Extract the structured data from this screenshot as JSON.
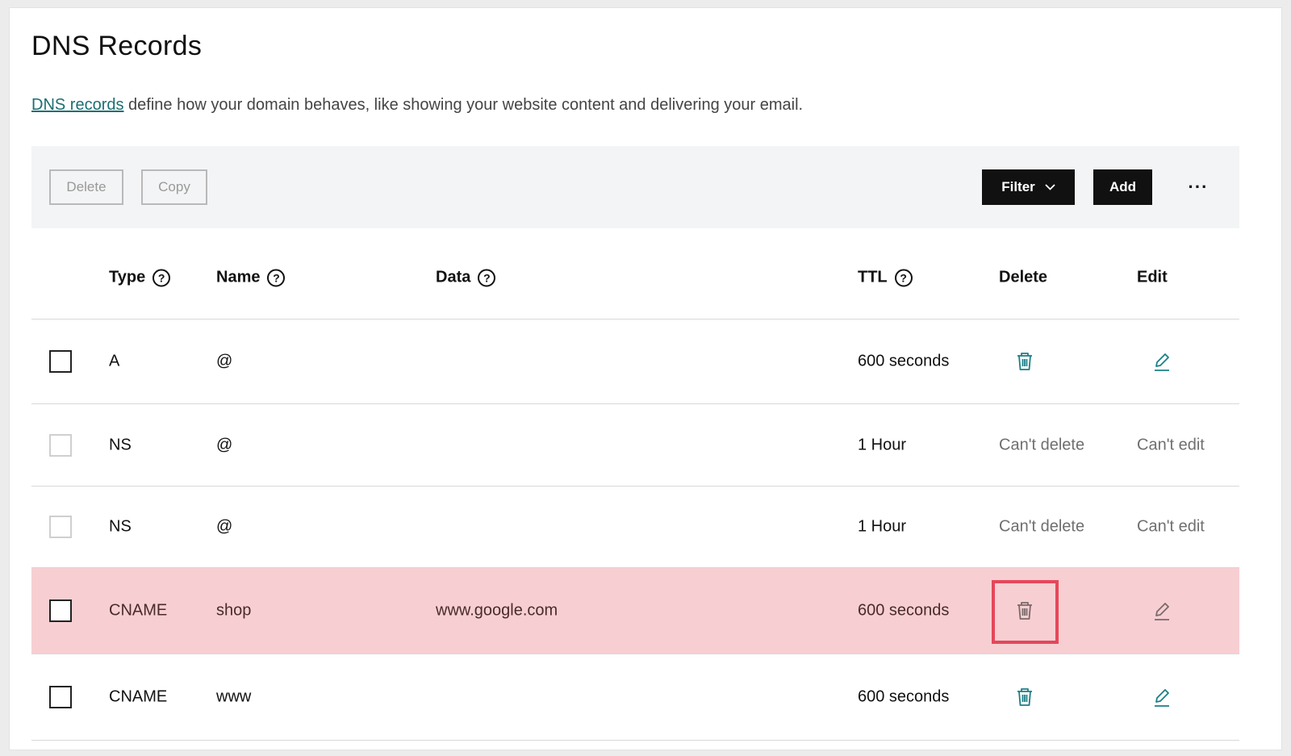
{
  "page": {
    "title": "DNS Records",
    "description_link": "DNS records",
    "description_rest": " define how your domain behaves, like showing your website content and delivering your email."
  },
  "toolbar": {
    "delete_label": "Delete",
    "copy_label": "Copy",
    "filter_label": "Filter",
    "add_label": "Add",
    "more_label": "···"
  },
  "columns": {
    "type": "Type",
    "name": "Name",
    "data": "Data",
    "ttl": "TTL",
    "delete": "Delete",
    "edit": "Edit",
    "help_symbol": "?"
  },
  "rows": [
    {
      "type": "A",
      "name": "@",
      "data": "",
      "ttl": "600 seconds",
      "delete": "trash-icon",
      "edit": "pencil-icon"
    },
    {
      "type": "NS",
      "name": "@",
      "data": "",
      "ttl": "1 Hour",
      "delete": "Can't delete",
      "edit": "Can't edit"
    },
    {
      "type": "NS",
      "name": "@",
      "data": "",
      "ttl": "1 Hour",
      "delete": "Can't delete",
      "edit": "Can't edit"
    },
    {
      "type": "CNAME",
      "name": "shop",
      "data": "www.google.com",
      "ttl": "600 seconds",
      "delete": "trash-icon",
      "edit": "pencil-icon",
      "highlighted": true
    },
    {
      "type": "CNAME",
      "name": "www",
      "data": "",
      "ttl": "600 seconds",
      "delete": "trash-icon",
      "edit": "pencil-icon"
    }
  ],
  "colors": {
    "link": "#1b6f72",
    "icon_teal": "#1b7f86",
    "highlight_row": "#f7cfd2",
    "focus_border": "#e5475a",
    "toolbar_bg": "#f3f4f5"
  }
}
